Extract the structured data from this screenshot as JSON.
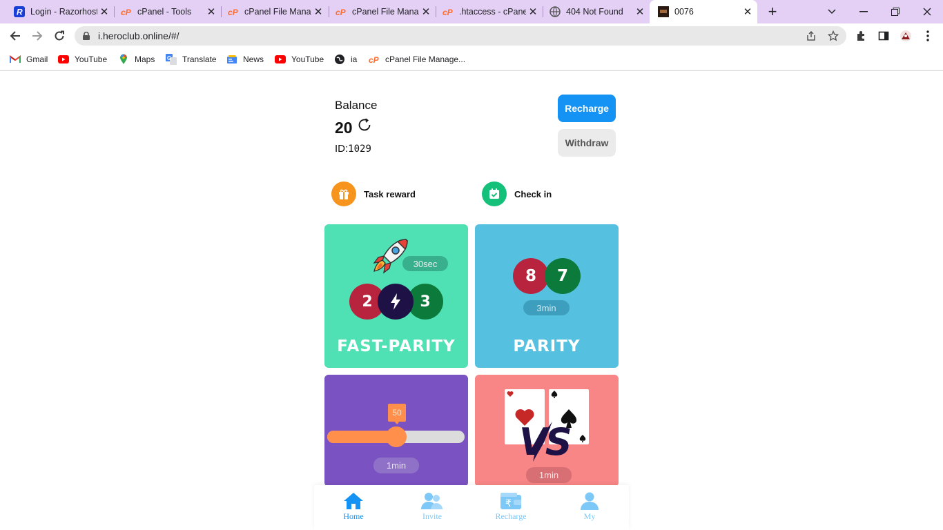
{
  "browser": {
    "tabs": [
      {
        "title": "Login - Razorhost",
        "icon": "razorhost-icon",
        "active": false
      },
      {
        "title": "cPanel - Tools",
        "icon": "cpanel-icon",
        "active": false
      },
      {
        "title": "cPanel File Manager",
        "icon": "cpanel-icon",
        "active": false
      },
      {
        "title": "cPanel File Manager",
        "icon": "cpanel-icon",
        "active": false
      },
      {
        "title": ".htaccess - cPanel",
        "icon": "cpanel-icon",
        "active": false
      },
      {
        "title": "404 Not Found",
        "icon": "globe-icon",
        "active": false
      },
      {
        "title": "0076",
        "icon": "site-icon",
        "active": true
      }
    ],
    "new_tab": "+",
    "url": "i.heroclub.online/#/",
    "bookmarks": [
      {
        "label": "Gmail",
        "icon": "gmail-icon"
      },
      {
        "label": "YouTube",
        "icon": "youtube-icon"
      },
      {
        "label": "Maps",
        "icon": "maps-icon"
      },
      {
        "label": "Translate",
        "icon": "translate-icon"
      },
      {
        "label": "News",
        "icon": "news-icon"
      },
      {
        "label": "YouTube",
        "icon": "youtube-icon"
      },
      {
        "label": "ia",
        "icon": "globe-icon"
      },
      {
        "label": "cPanel File Manage...",
        "icon": "cpanel-icon"
      }
    ]
  },
  "wallet": {
    "balance_label": "Balance",
    "balance": "20",
    "id_label": "ID:",
    "id_value": "1029",
    "recharge_label": "Recharge",
    "withdraw_label": "Withdraw"
  },
  "quick_actions": [
    {
      "label": "Task reward",
      "icon": "gift-icon",
      "color": "#f7941d"
    },
    {
      "label": "Check in",
      "icon": "calendar-check-icon",
      "color": "#14c07a"
    }
  ],
  "games": {
    "fast_parity": {
      "title": "FAST-PARITY",
      "time": "30sec",
      "ball_left": "2",
      "ball_right": "3",
      "bg": "#4fe0b4"
    },
    "parity": {
      "title": "PARITY",
      "time": "3min",
      "ball_left": "8",
      "ball_right": "7",
      "bg": "#55c0e0"
    },
    "slider": {
      "time": "1min",
      "value_label": "50",
      "level": 0.5,
      "bg": "#7b52c1"
    },
    "cards": {
      "time": "1min",
      "vs": "VS",
      "bg": "#f88686"
    }
  },
  "bottom_nav": [
    {
      "label": "Home",
      "icon": "home-icon",
      "active": true
    },
    {
      "label": "Invite",
      "icon": "invite-icon",
      "active": false
    },
    {
      "label": "Recharge",
      "icon": "wallet-icon",
      "active": false
    },
    {
      "label": "My",
      "icon": "user-icon",
      "active": false
    }
  ],
  "colors": {
    "primary": "#1493f5",
    "nav_inactive": "#7ec8f7",
    "ball_red": "#b8233d",
    "ball_green": "#0b7a3a",
    "ball_dark": "#1d1145",
    "slider_fill": "#ff8f4a"
  }
}
